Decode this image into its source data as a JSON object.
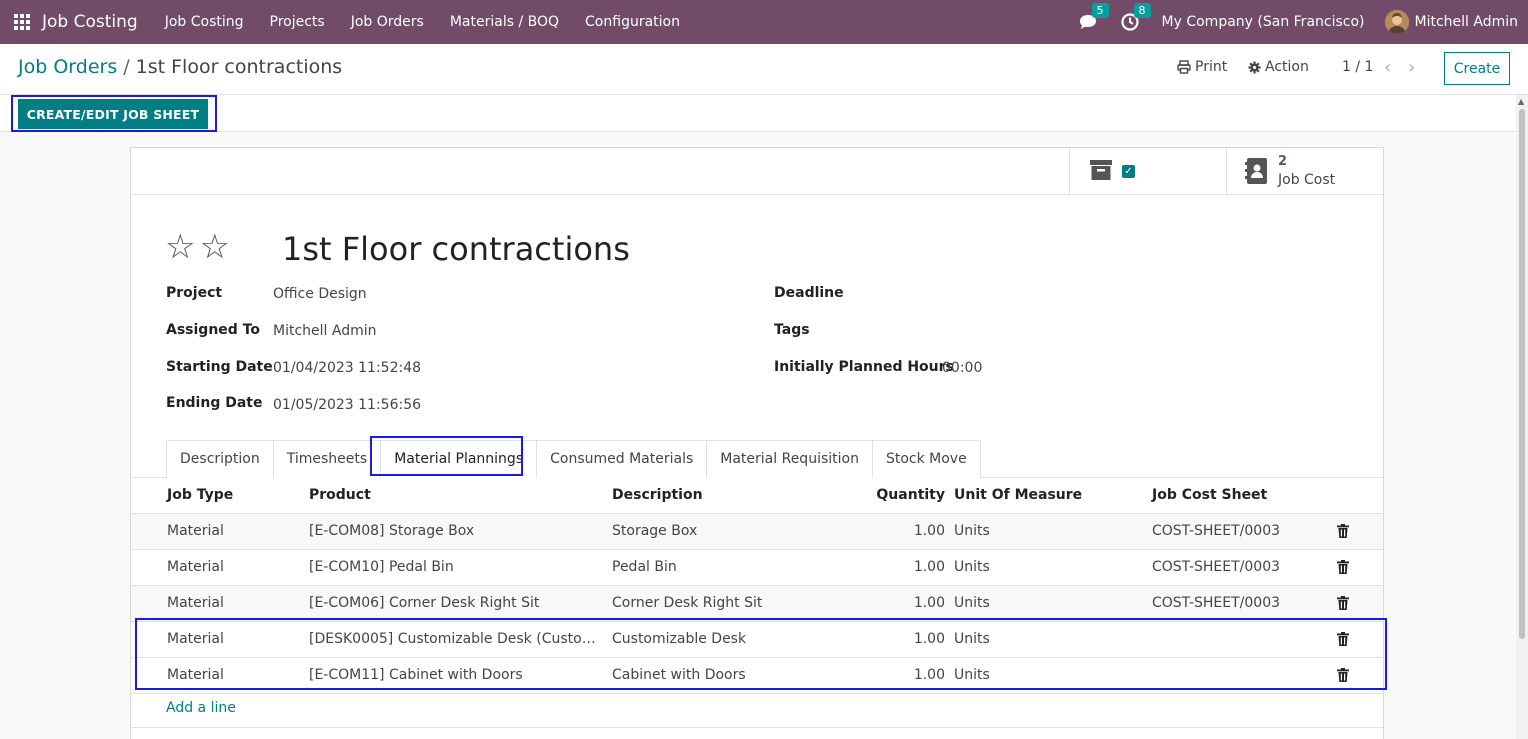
{
  "navbar": {
    "app_name": "Job Costing",
    "menu": [
      "Job Costing",
      "Projects",
      "Job Orders",
      "Materials / BOQ",
      "Configuration"
    ],
    "messages_count": "5",
    "activities_count": "8",
    "company": "My Company (San Francisco)",
    "user": "Mitchell Admin"
  },
  "control_panel": {
    "breadcrumb_parent": "Job Orders",
    "breadcrumb_sep": "/",
    "breadcrumb_current": "1st Floor contractions",
    "print_label": "Print",
    "action_label": "Action",
    "pager": "1 / 1",
    "create_label": "Create"
  },
  "statusbar": {
    "jobsheet_label": "CREATE/EDIT JOB SHEET"
  },
  "smart_buttons": {
    "jobcost_count": "2",
    "jobcost_label": "Job Cost"
  },
  "record": {
    "title": "1st Floor contractions",
    "fields_left": [
      {
        "label": "Project",
        "value": "Office Design"
      },
      {
        "label": "Assigned To",
        "value": "Mitchell Admin"
      },
      {
        "label": "Starting Date",
        "value": "01/04/2023 11:52:48"
      },
      {
        "label": "Ending Date",
        "value": "01/05/2023 11:56:56"
      }
    ],
    "fields_right": [
      {
        "label": "Deadline",
        "value": ""
      },
      {
        "label": "Tags",
        "value": ""
      },
      {
        "label": "Initially Planned Hours",
        "value": "00:00"
      }
    ]
  },
  "tabs": [
    "Description",
    "Timesheets",
    "Material Plannings",
    "Consumed Materials",
    "Material Requisition",
    "Stock Move"
  ],
  "active_tab": "Material Plannings",
  "table": {
    "columns": [
      "Job Type",
      "Product",
      "Description",
      "Quantity",
      "Unit Of Measure",
      "Job Cost Sheet"
    ],
    "rows": [
      {
        "job_type": "Material",
        "product": "[E-COM08] Storage Box",
        "description": "Storage Box",
        "quantity": "1.00",
        "uom": "Units",
        "sheet": "COST-SHEET/0003"
      },
      {
        "job_type": "Material",
        "product": "[E-COM10] Pedal Bin",
        "description": "Pedal Bin",
        "quantity": "1.00",
        "uom": "Units",
        "sheet": "COST-SHEET/0003"
      },
      {
        "job_type": "Material",
        "product": "[E-COM06] Corner Desk Right Sit",
        "description": "Corner Desk Right Sit",
        "quantity": "1.00",
        "uom": "Units",
        "sheet": "COST-SHEET/0003"
      },
      {
        "job_type": "Material",
        "product": "[DESK0005] Customizable Desk (Custom, W…",
        "description": "Customizable Desk",
        "quantity": "1.00",
        "uom": "Units",
        "sheet": ""
      },
      {
        "job_type": "Material",
        "product": "[E-COM11] Cabinet with Doors",
        "description": "Cabinet with Doors",
        "quantity": "1.00",
        "uom": "Units",
        "sheet": ""
      }
    ],
    "add_line_label": "Add a line"
  },
  "colors": {
    "navbar": "#714b67",
    "primary": "#017e84",
    "highlight": "#1a1ae0"
  },
  "icons": [
    "apps-grid-icon",
    "chat-icon",
    "clock-icon",
    "printer-icon",
    "gear-icon",
    "chevron-left-icon",
    "chevron-right-icon",
    "archive-icon",
    "checkbox-icon",
    "address-book-icon",
    "star-icon",
    "trash-icon"
  ]
}
